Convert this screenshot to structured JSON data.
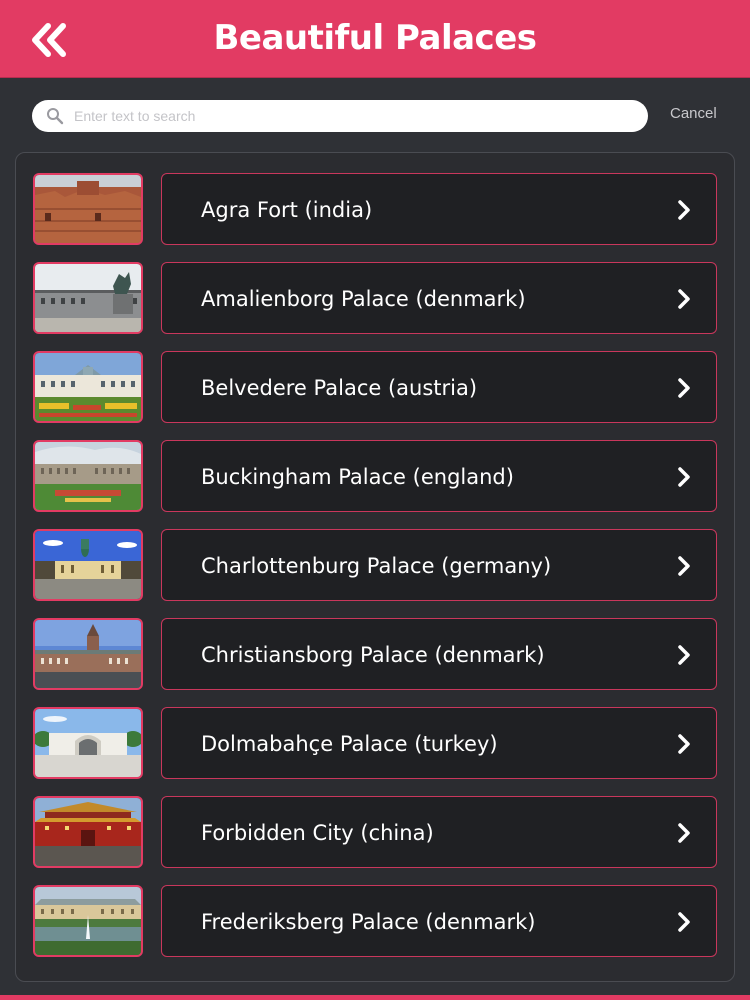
{
  "header": {
    "title": "Beautiful Palaces",
    "back_icon": "double-chevron-left-icon",
    "color": "#e23b63"
  },
  "search": {
    "placeholder": "Enter text to search",
    "value": "",
    "cancel_label": "Cancel"
  },
  "list": {
    "items": [
      {
        "label": "Agra Fort (india)"
      },
      {
        "label": "Amalienborg Palace (denmark)"
      },
      {
        "label": "Belvedere Palace (austria)"
      },
      {
        "label": "Buckingham Palace (england)"
      },
      {
        "label": "Charlottenburg Palace (germany)"
      },
      {
        "label": "Christiansborg Palace (denmark)"
      },
      {
        "label": "Dolmabahçe Palace (turkey)"
      },
      {
        "label": "Forbidden City (china)"
      },
      {
        "label": "Frederiksberg Palace (denmark)"
      }
    ]
  },
  "colors": {
    "accent": "#e23b63",
    "background": "#2f3136",
    "row_background": "#1f2023"
  }
}
